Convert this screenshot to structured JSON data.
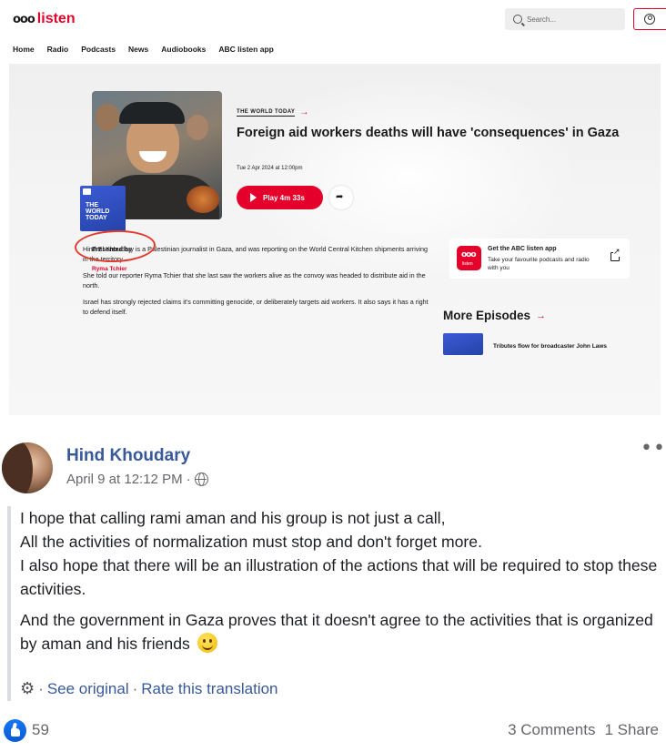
{
  "abc": {
    "logo_mark": "ooo",
    "logo_text": "listen",
    "search_placeholder": "Search...",
    "nav": [
      "Home",
      "Radio",
      "Podcasts",
      "News",
      "Audiobooks",
      "ABC listen app"
    ],
    "episode": {
      "program": "THE WORLD TODAY",
      "title": "Foreign aid workers deaths will have 'consequences' in Gaza",
      "date": "Tue 2 Apr 2024 at 12:00pm",
      "play_label": "Play 4m 33s",
      "show_tile_text": "THE WORLD TODAY",
      "presented_by_label": "Presented by",
      "presenter": "Ryma Tchier",
      "body": [
        "Hind El Khoudary is a Palestinian journalist in Gaza, and was reporting on the World Central Kitchen shipments arriving in the territory.",
        "She told our reporter Ryma Tchier that she last saw the workers alive as the convoy was headed to distribute aid in the north.",
        "Israel has strongly rejected claims it's committing genocide, or deliberately targets aid workers. It also says it has a right to defend itself."
      ]
    },
    "app_promo": {
      "icon_mark": "ooo",
      "icon_sub": "listen",
      "title": "Get the ABC listen app",
      "description": "Take your favourite podcasts and radio with you"
    },
    "more_episodes": {
      "title": "More Episodes",
      "first_item": "Tributes flow for broadcaster John Laws"
    },
    "colors": {
      "brand_red": "#e4002b"
    }
  },
  "facebook": {
    "author": "Hind Khoudary",
    "timestamp": "April 9 at 12:12 PM",
    "meta_separator": "·",
    "more_options": "•••",
    "paragraphs": [
      [
        "I hope that calling rami aman and his group is not just a call,",
        "All the activities of normalization must stop and don't forget more.",
        "I also hope that there will be an illustration of the actions that will be required to stop these activities."
      ],
      [
        "And the government in Gaza proves that it doesn't agree to the activities that is organized by aman and his friends"
      ]
    ],
    "translation": {
      "separator": "·",
      "see_original": "See original",
      "rate": "Rate this translation"
    },
    "likes": "59",
    "comments": "3 Comments",
    "shares": "1 Share",
    "colors": {
      "link_blue": "#385898",
      "like_blue": "#1877f2"
    }
  }
}
